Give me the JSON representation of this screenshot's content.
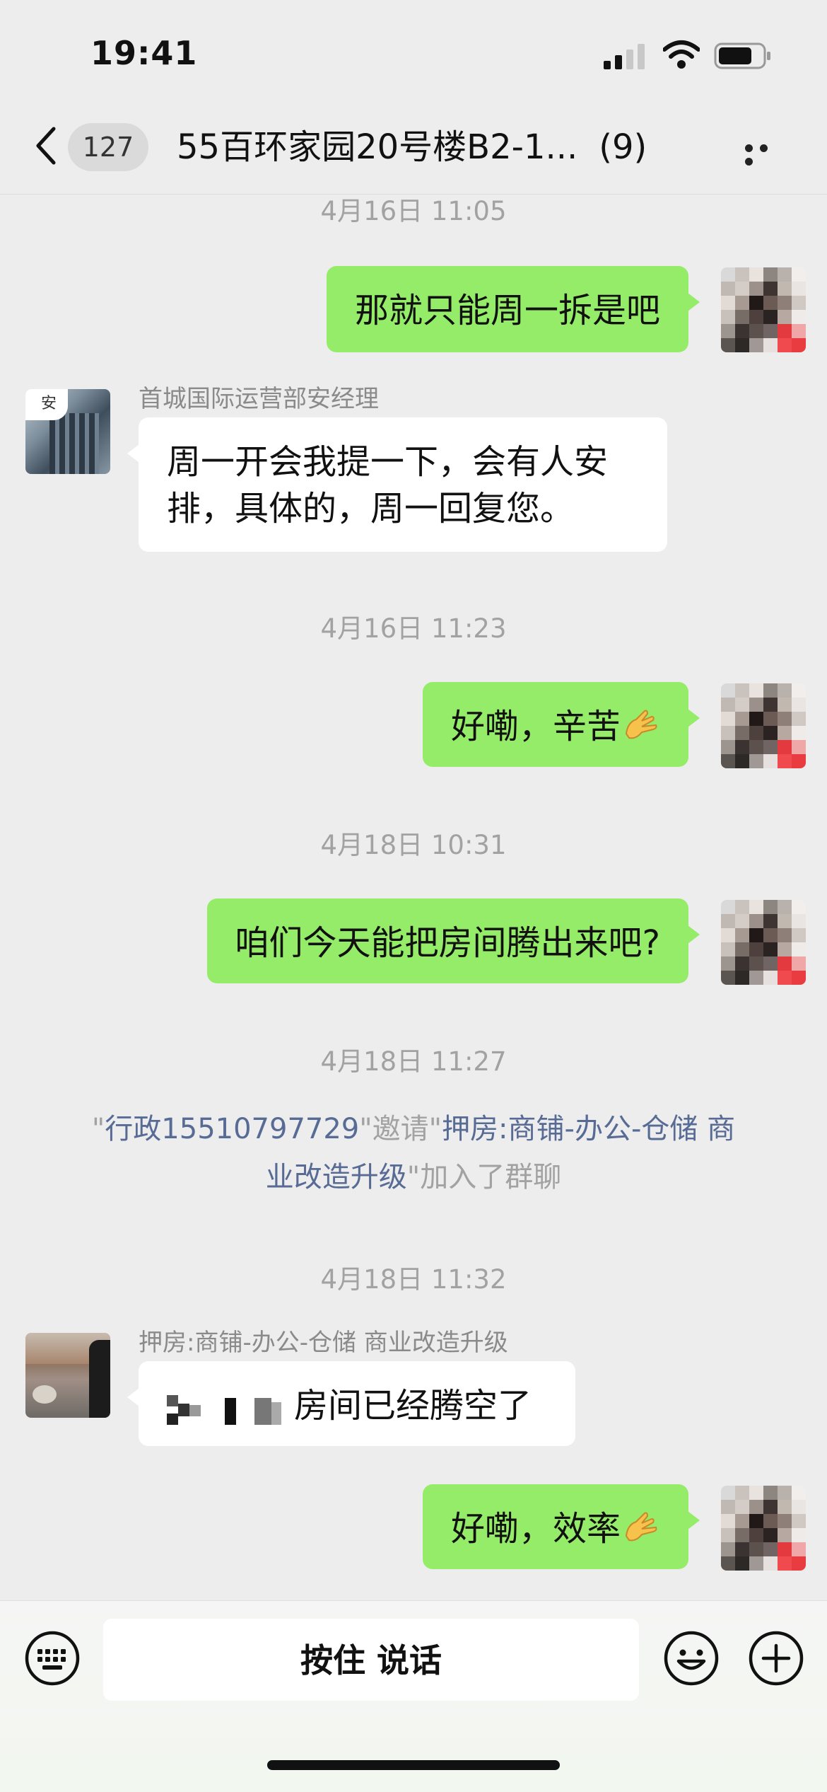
{
  "status_bar": {
    "time": "19:41"
  },
  "nav": {
    "unread_count": "127",
    "title": "55百环家园20号楼B2-1...",
    "member_count": "(9)"
  },
  "messages": [
    {
      "type": "timestamp",
      "text": "4月16日 11:05"
    },
    {
      "type": "outgoing",
      "text": "那就只能周一拆是吧"
    },
    {
      "type": "incoming",
      "sender": "首城国际运营部安经理",
      "avatar_label": "安",
      "line1": "周一开会我提一下，会有人安",
      "line2": "排，具体的，周一回复您。"
    },
    {
      "type": "timestamp",
      "text": "4月16日 11:23"
    },
    {
      "type": "outgoing",
      "text": "好嘞，辛苦"
    },
    {
      "type": "timestamp",
      "text": "4月18日 10:31"
    },
    {
      "type": "outgoing",
      "text": "咱们今天能把房间腾出来吧?"
    },
    {
      "type": "timestamp",
      "text": "4月18日 11:27"
    },
    {
      "type": "system",
      "q1": "\"",
      "inviter": "行政15510797729",
      "q2": "\"邀请\"",
      "invitee_part1": "押房:商铺-办公-仓储 商",
      "invitee_part2": "业改造升级",
      "q3": "\"加入了群聊"
    },
    {
      "type": "timestamp",
      "text": "4月18日 11:32"
    },
    {
      "type": "incoming",
      "sender": "押房:商铺-办公-仓储 商业改造升级",
      "text": "房间已经腾空了"
    },
    {
      "type": "outgoing",
      "text": "好嘞，效率"
    }
  ],
  "input": {
    "talk_label": "按住 说话"
  },
  "icons": [
    "back-icon",
    "more-icon",
    "keyboard-icon",
    "emoji-icon",
    "plus-icon",
    "ok-hand-emoji-icon"
  ],
  "colors": {
    "my_bubble": "#95ec69",
    "other_bubble": "#ffffff",
    "background": "#ededed",
    "link": "#576b95"
  }
}
